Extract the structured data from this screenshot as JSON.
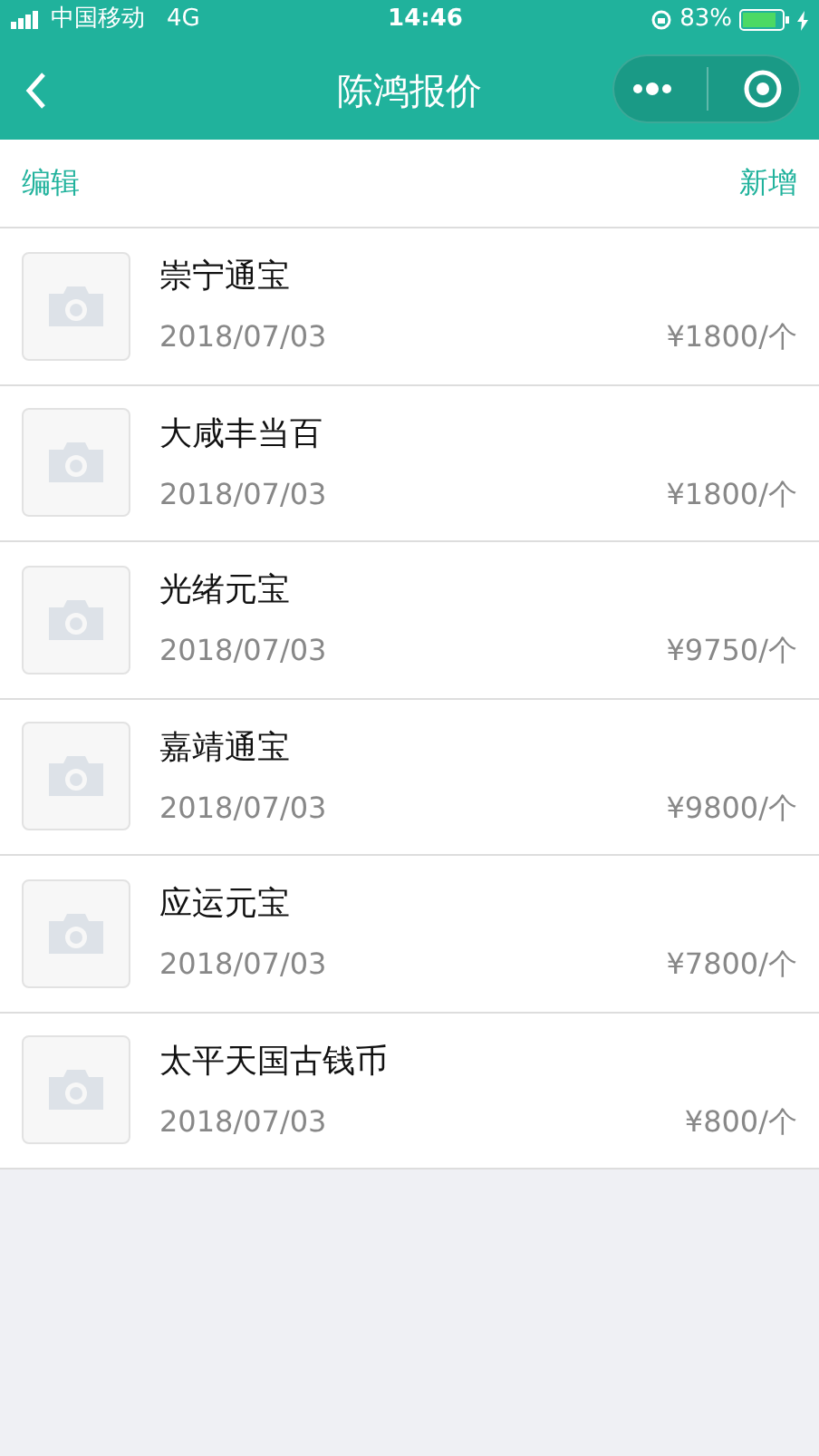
{
  "status_bar": {
    "carrier": "中国移动",
    "network": "4G",
    "time": "14:46",
    "battery": "83%"
  },
  "nav_bar": {
    "title": "陈鸿报价"
  },
  "toolbar": {
    "left": "编辑",
    "right": "新增"
  },
  "items": [
    {
      "name": "崇宁通宝",
      "date": "2018/07/03",
      "price": "¥1800/个"
    },
    {
      "name": "大咸丰当百",
      "date": "2018/07/03",
      "price": "¥1800/个"
    },
    {
      "name": "光绪元宝",
      "date": "2018/07/03",
      "price": "¥9750/个"
    },
    {
      "name": "嘉靖通宝",
      "date": "2018/07/03",
      "price": "¥9800/个"
    },
    {
      "name": "应运元宝",
      "date": "2018/07/03",
      "price": "¥7800/个"
    },
    {
      "name": "太平天国古钱币",
      "date": "2018/07/03",
      "price": "¥800/个"
    }
  ]
}
